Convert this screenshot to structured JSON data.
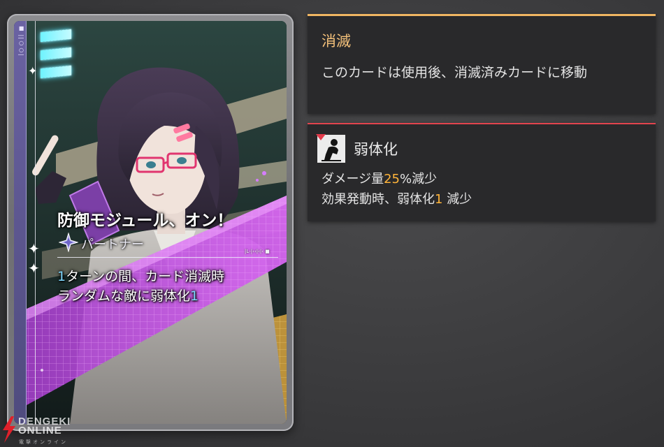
{
  "card": {
    "name": "防御モジュール、オン！",
    "type": "パートナー",
    "side_text": "■ ||○○|",
    "tag": "|L‑|‹‹|‹|‹ ■",
    "desc": {
      "line1_num": "1",
      "line1_text": "ターンの間、カード消滅時",
      "line2_text": "ランダムな敵に弱体化",
      "line2_num": "1"
    },
    "art_icon": "character-portrait",
    "type_icon": "star-crest-icon"
  },
  "exhaust_panel": {
    "title": "消滅",
    "desc": "このカードは使用後、消滅済みカードに移動"
  },
  "weak_panel": {
    "title": "弱体化",
    "icon": "weakened-figure-icon",
    "line1_pre": "ダメージ量",
    "line1_num": "25",
    "line1_post": "%減少",
    "line2_pre": "効果発動時、弱体化",
    "line2_num": "1",
    "line2_post": " 減少"
  },
  "watermark": {
    "brand_line1": "DENGEKI",
    "brand_line2": "ONLINE",
    "brand_sub": "電撃オンライン"
  },
  "colors": {
    "exhaust_accent": "#f0b662",
    "weak_accent": "#e2444e",
    "highlight_blue": "#7fd8ff",
    "highlight_orange": "#ffb43a"
  }
}
